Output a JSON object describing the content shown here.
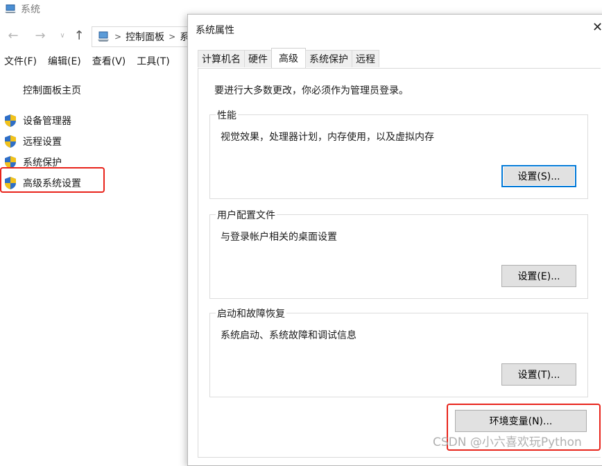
{
  "background_window": {
    "title": "系统",
    "address": {
      "crumb_1": "控制面板",
      "crumb_2_partial": "系"
    },
    "menu": [
      "文件(F)",
      "编辑(E)",
      "查看(V)",
      "工具(T)"
    ],
    "side_panel": {
      "home": "控制面板主页",
      "links": [
        "设备管理器",
        "远程设置",
        "系统保护",
        "高级系统设置"
      ]
    }
  },
  "dialog": {
    "title": "系统属性",
    "tabs": [
      "计算机名",
      "硬件",
      "高级",
      "系统保护",
      "远程"
    ],
    "active_tab": "高级",
    "admin_note": "要进行大多数更改，你必须作为管理员登录。",
    "groups": {
      "performance": {
        "title": "性能",
        "description": "视觉效果，处理器计划，内存使用，以及虚拟内存",
        "button": "设置(S)..."
      },
      "user_profiles": {
        "title": "用户配置文件",
        "description": "与登录帐户相关的桌面设置",
        "button": "设置(E)..."
      },
      "startup_recovery": {
        "title": "启动和故障恢复",
        "description": "系统启动、系统故障和调试信息",
        "button": "设置(T)..."
      }
    },
    "env_button": "环境变量(N)..."
  },
  "watermark": "CSDN @小六喜欢玩Python",
  "colors": {
    "highlight": "#e8231a",
    "focus": "#0078d7",
    "button_bg": "#e1e1e1"
  }
}
